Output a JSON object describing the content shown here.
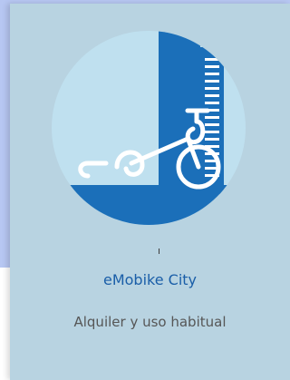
{
  "card": {
    "title": "eMobike City",
    "subtitle": "Alquiler y uso habitual",
    "icon": "bike-city-emblem-icon"
  },
  "colors": {
    "page_bg": "#b7c7f2",
    "card_bg": "#b8d3e1",
    "circle": "#bfe0ef",
    "building": "#1b6fb9",
    "title_text": "#1a5ea8",
    "subtitle_text": "#565656"
  }
}
